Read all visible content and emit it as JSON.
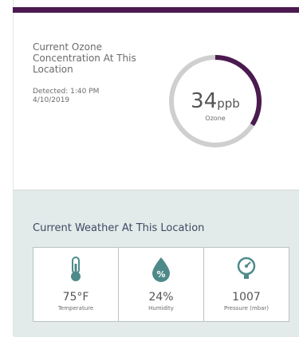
{
  "ozone": {
    "title": "Current Ozone Concentration At This Location",
    "detected": "Detected: 1:40 PM 4/10/2019",
    "value": "34",
    "unit": "ppb",
    "label": "Ozone",
    "gauge_fraction": 0.34,
    "gauge_color": "#4b1a4f",
    "gauge_track_color": "#cfcfcf"
  },
  "weather": {
    "title": "Current Weather At This Location",
    "items": [
      {
        "icon": "thermometer-icon",
        "value": "75°F",
        "label": "Temperature"
      },
      {
        "icon": "humidity-drop-icon",
        "value": "24%",
        "label": "Humidity"
      },
      {
        "icon": "pressure-gauge-icon",
        "value": "1007",
        "label": "Pressure (mbar)"
      }
    ]
  },
  "colors": {
    "accent": "#4b1a4f",
    "weather_bg": "#e3ebea",
    "icon_teal": "#4e8a8a",
    "title_blue": "#3c4a63"
  }
}
